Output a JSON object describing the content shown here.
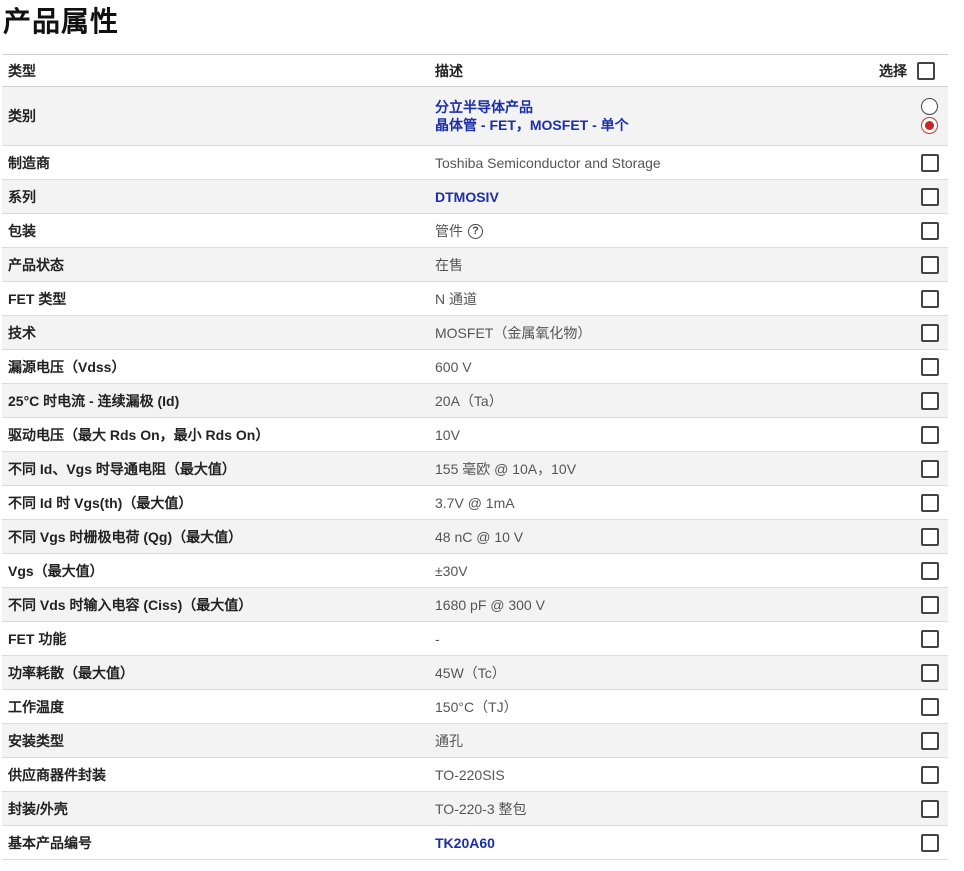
{
  "page_title": "产品属性",
  "table": {
    "header": {
      "type": "类型",
      "description": "描述",
      "select": "选择"
    },
    "category": {
      "label": "类别",
      "desc_line1": "分立半导体产品",
      "desc_line2": "晶体管 - FET，MOSFET - 单个"
    },
    "rows": [
      {
        "label": "制造商",
        "value": "Toshiba Semiconductor and Storage"
      },
      {
        "label": "系列",
        "value": "DTMOSIV"
      },
      {
        "label": "包装",
        "value": "管件"
      },
      {
        "label": "产品状态",
        "value": "在售"
      },
      {
        "label": "FET 类型",
        "value": "N 通道"
      },
      {
        "label": "技术",
        "value": "MOSFET（金属氧化物）"
      },
      {
        "label": "漏源电压（Vdss）",
        "value": "600 V"
      },
      {
        "label": "25°C 时电流 - 连续漏极 (Id)",
        "value": "20A（Ta）"
      },
      {
        "label": "驱动电压（最大 Rds On，最小 Rds On）",
        "value": "10V"
      },
      {
        "label": "不同 Id、Vgs 时导通电阻（最大值）",
        "value": "155 毫欧 @ 10A，10V"
      },
      {
        "label": "不同 Id 时 Vgs(th)（最大值）",
        "value": "3.7V @ 1mA"
      },
      {
        "label": "不同 Vgs 时栅极电荷 (Qg)（最大值）",
        "value": "48 nC @ 10 V"
      },
      {
        "label": "Vgs（最大值）",
        "value": "±30V"
      },
      {
        "label": "不同 Vds 时输入电容 (Ciss)（最大值）",
        "value": "1680 pF @ 300 V"
      },
      {
        "label": "FET 功能",
        "value": "-"
      },
      {
        "label": "功率耗散（最大值）",
        "value": "45W（Tc）"
      },
      {
        "label": "工作温度",
        "value": "150°C（TJ）"
      },
      {
        "label": "安装类型",
        "value": "通孔"
      },
      {
        "label": "供应商器件封装",
        "value": "TO-220SIS"
      },
      {
        "label": "封装/外壳",
        "value": "TO-220-3 整包"
      },
      {
        "label": "基本产品编号",
        "value": "TK20A60"
      }
    ],
    "help_icon_glyph": "?",
    "selected_category": "晶体管 - FET，MOSFET - 单个"
  },
  "colors": {
    "link": "#1a2fa8",
    "radio_selected": "#c62828"
  }
}
